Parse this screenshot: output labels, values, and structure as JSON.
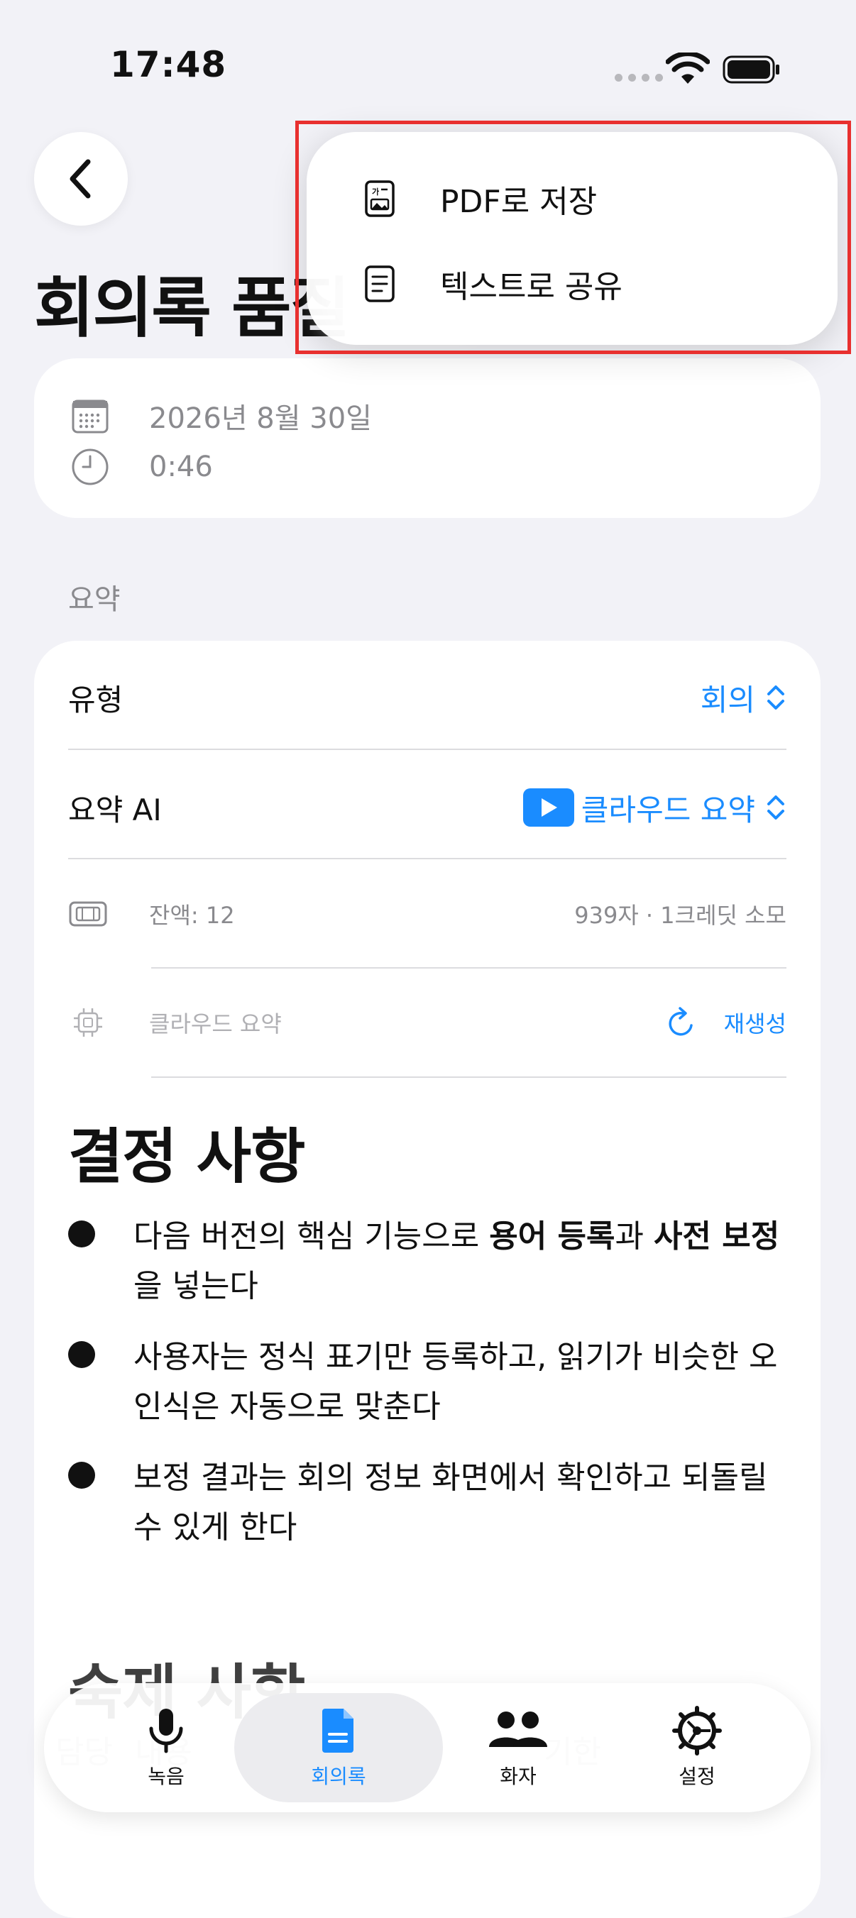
{
  "status_bar": {
    "time": "17:48"
  },
  "header": {
    "title": "회의록 품질"
  },
  "info": {
    "date": "2026년 8월 30일",
    "duration": "0:46"
  },
  "summary": {
    "section_label": "요약",
    "type_label": "유형",
    "type_value": "회의",
    "ai_label": "요약 AI",
    "ai_value": "클라우드 요약",
    "balance": "잔액: 12",
    "cost": "939자 · 1크레딧 소모",
    "engine": "클라우드 요약",
    "regenerate": "재생성"
  },
  "content": {
    "decisions_title": "결정 사항",
    "bullets": [
      {
        "pre": "다음 버전의 핵심 기능으로 ",
        "b1": "용어 등록",
        "mid": "과 ",
        "b2": "사전 보정",
        "post": "을 넣는다"
      },
      {
        "text": "사용자는 정식 표기만 등록하고, 읽기가 비슷한 오인식은 자동으로 맞춘다"
      },
      {
        "text": "보정 결과는 회의 정보 화면에서 확인하고 되돌릴 수 있게 한다"
      }
    ],
    "action_title": "숙제 사항",
    "columns": [
      "담당",
      "내용",
      "기한"
    ]
  },
  "tabs": [
    {
      "label": "녹음",
      "icon": "mic-icon"
    },
    {
      "label": "회의록",
      "icon": "document-icon",
      "active": true
    },
    {
      "label": "화자",
      "icon": "people-icon"
    },
    {
      "label": "설정",
      "icon": "gear-icon"
    }
  ],
  "menu": {
    "items": [
      {
        "label": "PDF로 저장",
        "icon": "pdf-doc-icon"
      },
      {
        "label": "텍스트로 공유",
        "icon": "text-doc-icon"
      }
    ]
  },
  "colors": {
    "accent": "#1a8cff",
    "background": "#f2f2f7",
    "highlight": "#e8302f"
  }
}
